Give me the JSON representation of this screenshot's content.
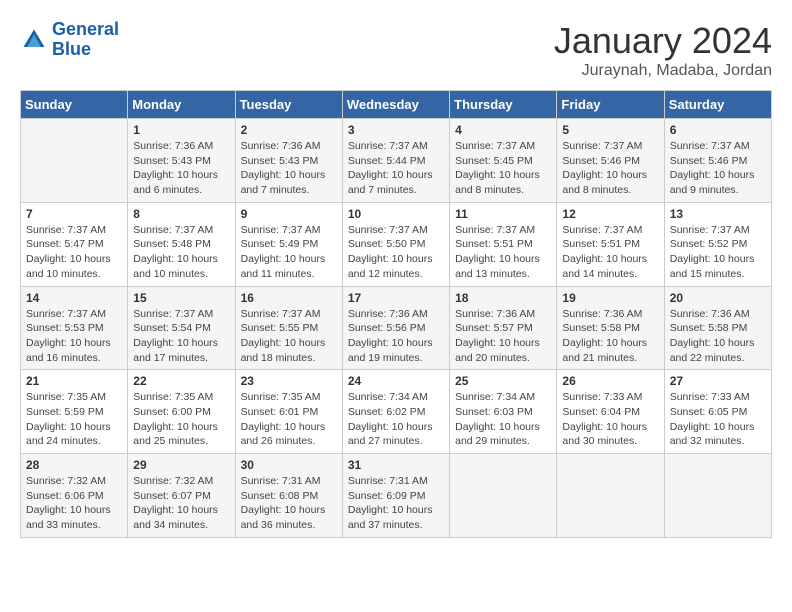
{
  "header": {
    "logo_line1": "General",
    "logo_line2": "Blue",
    "title": "January 2024",
    "subtitle": "Juraynah, Madaba, Jordan"
  },
  "days_of_week": [
    "Sunday",
    "Monday",
    "Tuesday",
    "Wednesday",
    "Thursday",
    "Friday",
    "Saturday"
  ],
  "weeks": [
    [
      {
        "day": "",
        "info": ""
      },
      {
        "day": "1",
        "info": "Sunrise: 7:36 AM\nSunset: 5:43 PM\nDaylight: 10 hours\nand 6 minutes."
      },
      {
        "day": "2",
        "info": "Sunrise: 7:36 AM\nSunset: 5:43 PM\nDaylight: 10 hours\nand 7 minutes."
      },
      {
        "day": "3",
        "info": "Sunrise: 7:37 AM\nSunset: 5:44 PM\nDaylight: 10 hours\nand 7 minutes."
      },
      {
        "day": "4",
        "info": "Sunrise: 7:37 AM\nSunset: 5:45 PM\nDaylight: 10 hours\nand 8 minutes."
      },
      {
        "day": "5",
        "info": "Sunrise: 7:37 AM\nSunset: 5:46 PM\nDaylight: 10 hours\nand 8 minutes."
      },
      {
        "day": "6",
        "info": "Sunrise: 7:37 AM\nSunset: 5:46 PM\nDaylight: 10 hours\nand 9 minutes."
      }
    ],
    [
      {
        "day": "7",
        "info": "Sunrise: 7:37 AM\nSunset: 5:47 PM\nDaylight: 10 hours\nand 10 minutes."
      },
      {
        "day": "8",
        "info": "Sunrise: 7:37 AM\nSunset: 5:48 PM\nDaylight: 10 hours\nand 10 minutes."
      },
      {
        "day": "9",
        "info": "Sunrise: 7:37 AM\nSunset: 5:49 PM\nDaylight: 10 hours\nand 11 minutes."
      },
      {
        "day": "10",
        "info": "Sunrise: 7:37 AM\nSunset: 5:50 PM\nDaylight: 10 hours\nand 12 minutes."
      },
      {
        "day": "11",
        "info": "Sunrise: 7:37 AM\nSunset: 5:51 PM\nDaylight: 10 hours\nand 13 minutes."
      },
      {
        "day": "12",
        "info": "Sunrise: 7:37 AM\nSunset: 5:51 PM\nDaylight: 10 hours\nand 14 minutes."
      },
      {
        "day": "13",
        "info": "Sunrise: 7:37 AM\nSunset: 5:52 PM\nDaylight: 10 hours\nand 15 minutes."
      }
    ],
    [
      {
        "day": "14",
        "info": "Sunrise: 7:37 AM\nSunset: 5:53 PM\nDaylight: 10 hours\nand 16 minutes."
      },
      {
        "day": "15",
        "info": "Sunrise: 7:37 AM\nSunset: 5:54 PM\nDaylight: 10 hours\nand 17 minutes."
      },
      {
        "day": "16",
        "info": "Sunrise: 7:37 AM\nSunset: 5:55 PM\nDaylight: 10 hours\nand 18 minutes."
      },
      {
        "day": "17",
        "info": "Sunrise: 7:36 AM\nSunset: 5:56 PM\nDaylight: 10 hours\nand 19 minutes."
      },
      {
        "day": "18",
        "info": "Sunrise: 7:36 AM\nSunset: 5:57 PM\nDaylight: 10 hours\nand 20 minutes."
      },
      {
        "day": "19",
        "info": "Sunrise: 7:36 AM\nSunset: 5:58 PM\nDaylight: 10 hours\nand 21 minutes."
      },
      {
        "day": "20",
        "info": "Sunrise: 7:36 AM\nSunset: 5:58 PM\nDaylight: 10 hours\nand 22 minutes."
      }
    ],
    [
      {
        "day": "21",
        "info": "Sunrise: 7:35 AM\nSunset: 5:59 PM\nDaylight: 10 hours\nand 24 minutes."
      },
      {
        "day": "22",
        "info": "Sunrise: 7:35 AM\nSunset: 6:00 PM\nDaylight: 10 hours\nand 25 minutes."
      },
      {
        "day": "23",
        "info": "Sunrise: 7:35 AM\nSunset: 6:01 PM\nDaylight: 10 hours\nand 26 minutes."
      },
      {
        "day": "24",
        "info": "Sunrise: 7:34 AM\nSunset: 6:02 PM\nDaylight: 10 hours\nand 27 minutes."
      },
      {
        "day": "25",
        "info": "Sunrise: 7:34 AM\nSunset: 6:03 PM\nDaylight: 10 hours\nand 29 minutes."
      },
      {
        "day": "26",
        "info": "Sunrise: 7:33 AM\nSunset: 6:04 PM\nDaylight: 10 hours\nand 30 minutes."
      },
      {
        "day": "27",
        "info": "Sunrise: 7:33 AM\nSunset: 6:05 PM\nDaylight: 10 hours\nand 32 minutes."
      }
    ],
    [
      {
        "day": "28",
        "info": "Sunrise: 7:32 AM\nSunset: 6:06 PM\nDaylight: 10 hours\nand 33 minutes."
      },
      {
        "day": "29",
        "info": "Sunrise: 7:32 AM\nSunset: 6:07 PM\nDaylight: 10 hours\nand 34 minutes."
      },
      {
        "day": "30",
        "info": "Sunrise: 7:31 AM\nSunset: 6:08 PM\nDaylight: 10 hours\nand 36 minutes."
      },
      {
        "day": "31",
        "info": "Sunrise: 7:31 AM\nSunset: 6:09 PM\nDaylight: 10 hours\nand 37 minutes."
      },
      {
        "day": "",
        "info": ""
      },
      {
        "day": "",
        "info": ""
      },
      {
        "day": "",
        "info": ""
      }
    ]
  ]
}
